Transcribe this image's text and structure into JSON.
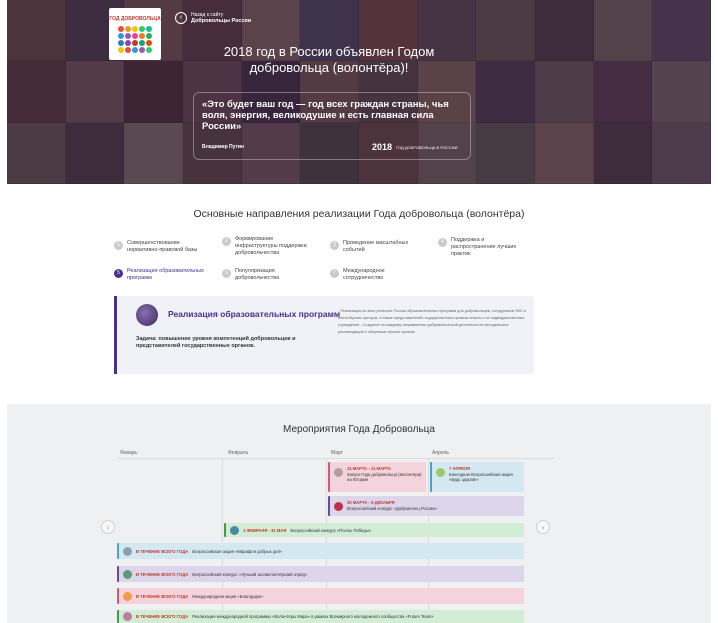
{
  "hero": {
    "logo_text": "ГОД ДОБРОВОЛЬЦА",
    "back_small": "Назад к сайту",
    "back_label": "Добровольцы России",
    "title": "2018 год в России объявлен Годом добровольца (волонтёра)!",
    "quote": "«Это будет ваш год — год всех граждан страны, чья воля, энергия, великодушие и есть главная сила России»",
    "author": "Владимир Путин",
    "year": "2018",
    "year_label": "ГОД ДОБРОВОЛЬЦА В РОССИИ"
  },
  "directions": {
    "title": "Основные направления реализации Года добровольца (волонтёра)",
    "items": [
      {
        "num": "1",
        "label": "Совершенствование нормативно-правовой базы"
      },
      {
        "num": "2",
        "label": "Формирование инфраструктуры поддержки добровольчества"
      },
      {
        "num": "3",
        "label": "Проведение масштабных событий"
      },
      {
        "num": "4",
        "label": "Поддержка и распространение лучших практик"
      },
      {
        "num": "5",
        "label": "Реализация образовательных программ"
      },
      {
        "num": "6",
        "label": "Популяризация добровольчества"
      },
      {
        "num": "7",
        "label": "Международное сотрудничество"
      }
    ],
    "card": {
      "title": "Реализация образовательных программ",
      "task": "Задача: повышение уровня компетенций добровольцев и представителей государственных органов.",
      "desc": "- Реализация во всех регионах России образовательных программ для добровольцев, сотрудников НКО и волонтёрских центров, а также представителей государственных органов власти и их подведомственных учреждений - Создание по каждому направлению добровольческой деятельности методических рекомендаций и сборников лучших практик"
    }
  },
  "events": {
    "title": "Мероприятия Года Добровольца",
    "months": [
      "Январь",
      "Февраль",
      "Март",
      "Апрель"
    ],
    "prev": "‹",
    "next": "›",
    "items": [
      {
        "date": "11 МАРТА - 11 МАРТА",
        "text": "Запуск Года добровольца (волонтёра) на Югорме"
      },
      {
        "date": "7 АПРЕЛЯ",
        "text": "Ежегодная Всероссийская акция «Будь здоров!»"
      },
      {
        "date": "30 МАРТА - 5 ДЕКАБРЯ",
        "text": "Всероссийский конкурс «Доброволец России»"
      },
      {
        "date": "1 ФЕВРАЛЯ - 31 МАЯ",
        "text": "Всероссийский конкурс «Послы Победы»"
      },
      {
        "date": "В ТЕЧЕНИЕ ВСЕГО ГОДА",
        "text": "Всероссийская акция «Марафон добрых дел»"
      },
      {
        "date": "В ТЕЧЕНИЕ ВСЕГО ГОДА",
        "text": "Всероссийский конкурс «Лучший экоэволонтёрский отряд»"
      },
      {
        "date": "В ТЕЧЕНИЕ ВСЕГО ГОДА",
        "text": "Международная акция «Благодарю»"
      },
      {
        "date": "В ТЕЧЕНИЕ ВСЕГО ГОДА",
        "text": "Реализация международной программы «Волонтёры Мира» в рамках Всемирного молодежного сообщества «Future Team»"
      }
    ]
  },
  "colors": {
    "accent": "#4a2f8a",
    "event_pink": "#f4d3dc",
    "event_blue": "#d3e8f1",
    "event_purple": "#ddd6ea",
    "event_green": "#d3ecd5",
    "event_orange": "#f4c7a6"
  }
}
